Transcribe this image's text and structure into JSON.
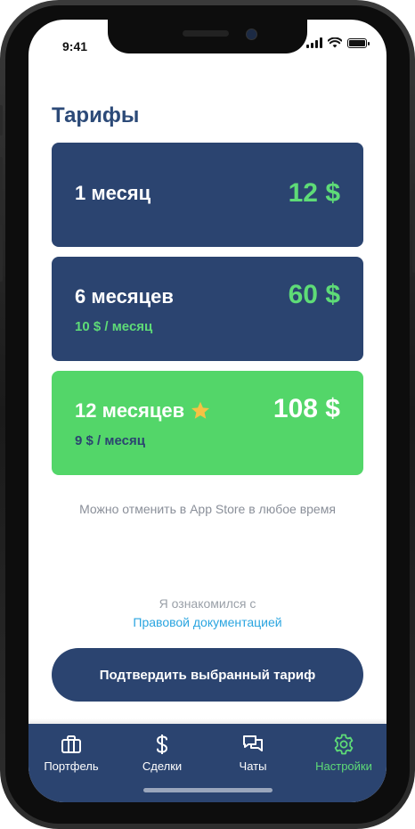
{
  "status_bar": {
    "time": "9:41"
  },
  "title": "Тарифы",
  "plans": [
    {
      "name": "1 месяц",
      "price": "12 $",
      "subtitle": "",
      "featured": false
    },
    {
      "name": "6 месяцев",
      "price": "60 $",
      "subtitle": "10 $ / месяц",
      "featured": false
    },
    {
      "name": "12 месяцев",
      "price": "108 $",
      "subtitle": "9 $ / месяц",
      "featured": true
    }
  ],
  "cancel_note": "Можно отменить в App Store в любое время",
  "agreement": {
    "text": "Я ознакомился с",
    "link": "Правовой документацией"
  },
  "confirm_button": "Подтвердить выбранный тариф",
  "tabbar": {
    "items": [
      {
        "label": "Портфель",
        "icon": "briefcase-icon",
        "active": false
      },
      {
        "label": "Сделки",
        "icon": "dollar-icon",
        "active": false
      },
      {
        "label": "Чаты",
        "icon": "chat-icon",
        "active": false
      },
      {
        "label": "Настройки",
        "icon": "gear-icon",
        "active": true
      }
    ]
  },
  "colors": {
    "navy": "#2b4470",
    "green": "#53d669",
    "accent_green": "#5edb77",
    "link": "#2aa5e0"
  }
}
